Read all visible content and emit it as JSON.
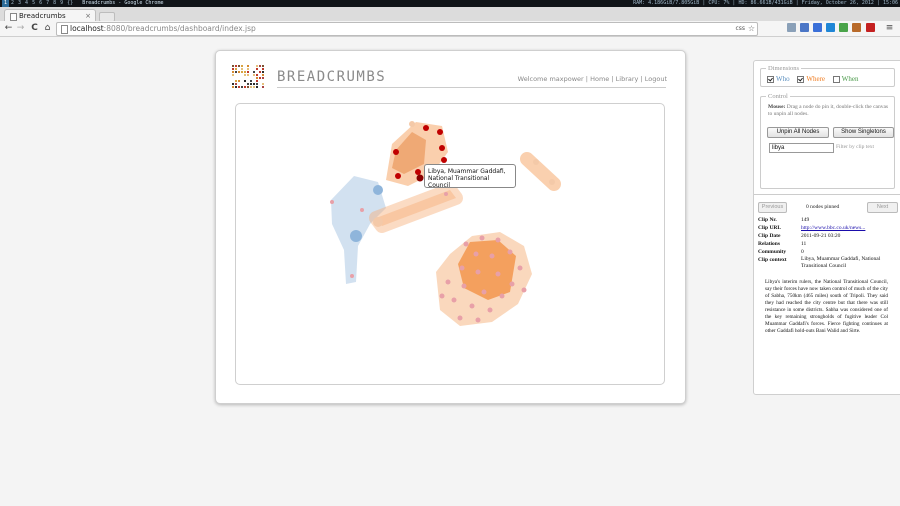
{
  "system_bar": {
    "workspaces": [
      "1",
      "2",
      "3",
      "4",
      "5",
      "6",
      "7",
      "8",
      "9",
      "{}"
    ],
    "active_window": "Breadcrumbs - Google Chrome",
    "status": "RAM: 4.186GiB/7.805GiB | CPU: 7% | HD: 86.661B/431GiB | Friday, October 26, 2012 | 15:06"
  },
  "browser": {
    "tab_title": "Breadcrumbs",
    "tab_close": "×",
    "url_host": "localhost",
    "url_path": ":8080/breadcrumbs/dashboard/index.jsp",
    "css_badge": "css",
    "back_icon": "←",
    "forward_icon": "→",
    "reload_icon": "C",
    "home_icon": "⌂",
    "star_icon": "☆",
    "menu_icon": "≡"
  },
  "app": {
    "brand": "BREADCRUMBS",
    "nav": {
      "welcome": "Welcome maxpower",
      "sep1": "|",
      "home": "Home",
      "sep2": "|",
      "library": "Library",
      "sep3": "|",
      "logout": "Logout"
    },
    "tooltip": "Libya, Muammar Gaddafi, National Transitional Council",
    "colors": {
      "who": "#5b8fbf",
      "where": "#f07b1e",
      "when": "#4a9a4a",
      "node_selected": "#c00000",
      "node_pink": "#e8a0a8"
    }
  },
  "sidebar": {
    "dimensions_legend": "Dimensions",
    "dimensions": [
      {
        "label": "Who",
        "checked": true
      },
      {
        "label": "Where",
        "checked": true
      },
      {
        "label": "When",
        "checked": false
      }
    ],
    "control_legend": "Control",
    "control_help_bold": "Mouse:",
    "control_help": "Drag a node do pin it, double-click the canvas to unpin all nodes.",
    "unpin_button": "Unpin All Nodes",
    "singletons_button": "Show Singletons",
    "filter_value": "libya",
    "filter_hint": "Filter by clip text",
    "prev_button": "Previous",
    "next_button": "Next",
    "pinned_text": "0 nodes pinned",
    "details": [
      {
        "key": "Clip Nr.",
        "value": "149"
      },
      {
        "key": "Clip URL",
        "value": "http://www.bbc.co.uk/news..."
      },
      {
        "key": "Clip Date",
        "value": "2011-09-21 03:20"
      },
      {
        "key": "Relations",
        "value": "11"
      },
      {
        "key": "Community",
        "value": "0"
      },
      {
        "key": "Clip context",
        "value": "Libya, Muammar Gaddafi, National Transitional Council"
      }
    ],
    "clip_text": "Libya's interim rulers, the National Transitional Council, say their forces have now taken control of much of the city of Sabha, 750km (465 miles) south of Tripoli. They said they had reached the city centre but that there was still resistance in some districts. Sabha was considered one of the key remaining strongholds of fugitive leader Col Muammar Gaddafi's forces. Fierce fighting continues at other Gaddafi hold-outs Bani Walid and Sirte."
  }
}
